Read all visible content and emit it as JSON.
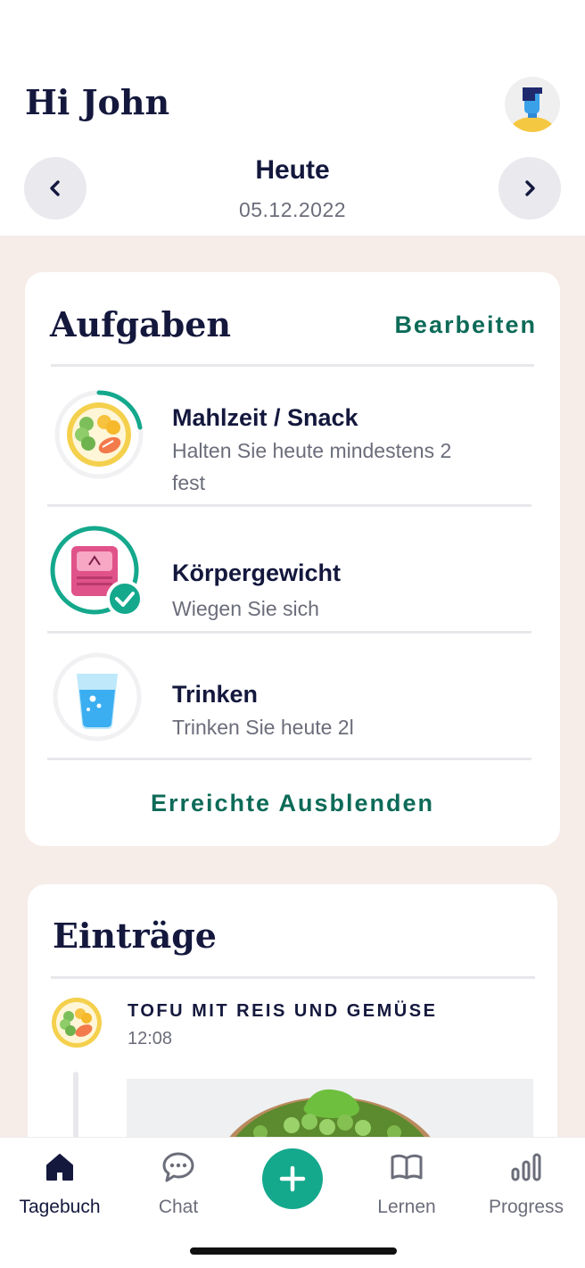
{
  "header": {
    "greeting": "Hi John",
    "day_title": "Heute",
    "day_date": "05.12.2022"
  },
  "tasks_card": {
    "title": "Aufgaben",
    "edit_label": "Bearbeiten",
    "items": [
      {
        "title": "Mahlzeit / Snack",
        "subtitle_line1": "Halten Sie heute mindestens 2",
        "subtitle_line2": "fest",
        "icon": "meal-plate-icon",
        "progress": 0.3
      },
      {
        "title": "Körpergewicht",
        "subtitle": "Wiegen Sie sich",
        "icon": "scale-icon",
        "completed": true
      },
      {
        "title": "Trinken",
        "subtitle": "Trinken Sie heute 2l",
        "icon": "water-glass-icon",
        "progress": 0
      }
    ],
    "hide_label": "Erreichte Ausblenden"
  },
  "entries_card": {
    "title": "Einträge",
    "entry": {
      "title": "TOFU MIT REIS UND GEMÜSE",
      "time": "12:08"
    }
  },
  "tabbar": {
    "tabs": [
      {
        "label": "Tagebuch",
        "icon": "home-icon",
        "active": true
      },
      {
        "label": "Chat",
        "icon": "chat-bubble-icon"
      },
      {
        "label": "Lernen",
        "icon": "book-icon"
      },
      {
        "label": "Progress",
        "icon": "bar-chart-icon"
      }
    ],
    "add_icon": "plus-icon"
  },
  "colors": {
    "accent": "#14a88c",
    "accent_text": "#0d6b58",
    "navy": "#14183d",
    "background": "#f6ece8"
  }
}
